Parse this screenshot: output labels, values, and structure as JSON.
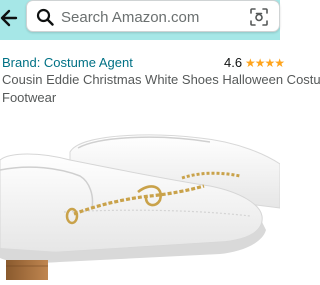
{
  "search": {
    "placeholder": "Search Amazon.com"
  },
  "product": {
    "brand_label": "Brand: Costume Agent",
    "rating": "4.6",
    "stars": "★★★★",
    "title_line1": "Cousin Eddie Christmas White Shoes Halloween Costum",
    "title_line2": "Footwear"
  },
  "icons": {
    "back": "back-arrow-icon",
    "search": "search-icon",
    "camera": "camera-scan-icon"
  },
  "colors": {
    "header_bg": "#a6e7e7",
    "link": "#007185",
    "star": "#ffa41c",
    "text_secondary": "#565959"
  }
}
